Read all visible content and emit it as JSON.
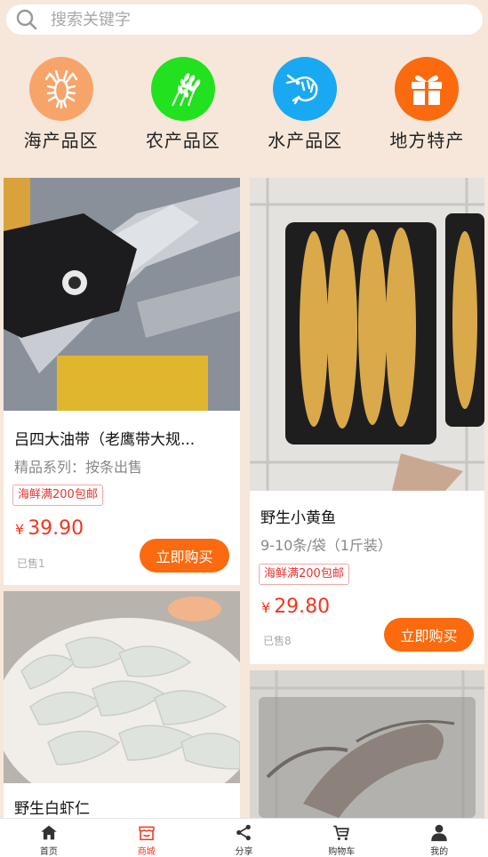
{
  "search": {
    "placeholder": "搜索关键字"
  },
  "categories": [
    {
      "label": "海产品区",
      "icon": "lobster-icon",
      "color": "#f7a46b"
    },
    {
      "label": "农产品区",
      "icon": "wheat-icon",
      "color": "#22e11e"
    },
    {
      "label": "水产品区",
      "icon": "shrimp-icon",
      "color": "#19a9f2"
    },
    {
      "label": "地方特产",
      "icon": "gift-icon",
      "color": "#fb6a0e"
    }
  ],
  "products": [
    {
      "title": "吕四大油带（老鹰带大规...",
      "subtitle": "精品系列：按条出售",
      "tag": "海鲜满200包邮",
      "currency": "¥",
      "price": "39.90",
      "sold": "已售1",
      "buy_label": "立即购买"
    },
    {
      "title": "野生小黄鱼",
      "subtitle": "9-10条/袋（1斤装）",
      "tag": "海鲜满200包邮",
      "currency": "¥",
      "price": "29.80",
      "sold": "已售8",
      "buy_label": "立即购买"
    },
    {
      "title": "野生白虾仁"
    }
  ],
  "tabbar": [
    {
      "label": "首页",
      "icon": "home-icon"
    },
    {
      "label": "商城",
      "icon": "shop-icon",
      "active": true
    },
    {
      "label": "分享",
      "icon": "share-icon"
    },
    {
      "label": "购物车",
      "icon": "cart-icon"
    },
    {
      "label": "我的",
      "icon": "user-icon"
    }
  ]
}
